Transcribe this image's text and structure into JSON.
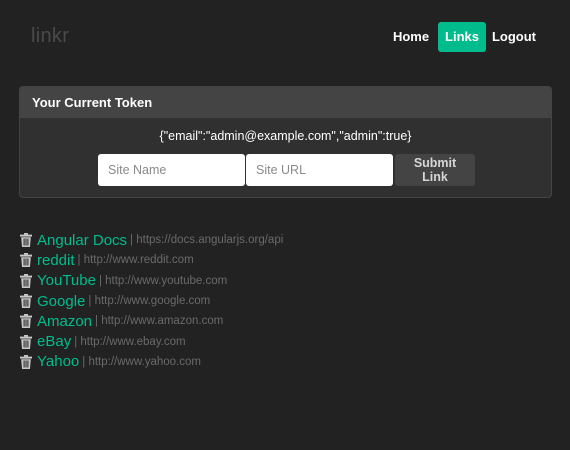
{
  "nav": {
    "brand": "linkr",
    "items": [
      {
        "label": "Home",
        "active": false
      },
      {
        "label": "Links",
        "active": true
      },
      {
        "label": "Logout",
        "active": false
      }
    ]
  },
  "panel": {
    "title": "Your Current Token",
    "token": "{\"email\":\"admin@example.com\",\"admin\":true}"
  },
  "form": {
    "site_name_placeholder": "Site Name",
    "site_url_placeholder": "Site URL",
    "submit_label": "Submit Link"
  },
  "links": [
    {
      "title": "Angular Docs",
      "url": "https://docs.angularjs.org/api",
      "delete_icon": "trash-icon"
    },
    {
      "title": "reddit",
      "url": "http://www.reddit.com",
      "delete_icon": "trash-icon"
    },
    {
      "title": "YouTube",
      "url": "http://www.youtube.com",
      "delete_icon": "trash-icon"
    },
    {
      "title": "Google",
      "url": "http://www.google.com",
      "delete_icon": "trash-icon"
    },
    {
      "title": "Amazon",
      "url": "http://www.amazon.com",
      "delete_icon": "trash-icon"
    },
    {
      "title": "eBay",
      "url": "http://www.ebay.com",
      "delete_icon": "trash-icon"
    },
    {
      "title": "Yahoo",
      "url": "http://www.yahoo.com",
      "delete_icon": "trash-icon"
    }
  ],
  "colors": {
    "background": "#222222",
    "accent": "#00bc8c",
    "panel": "#303030",
    "panel_heading": "#444444",
    "muted_text": "#6a6a6a"
  }
}
